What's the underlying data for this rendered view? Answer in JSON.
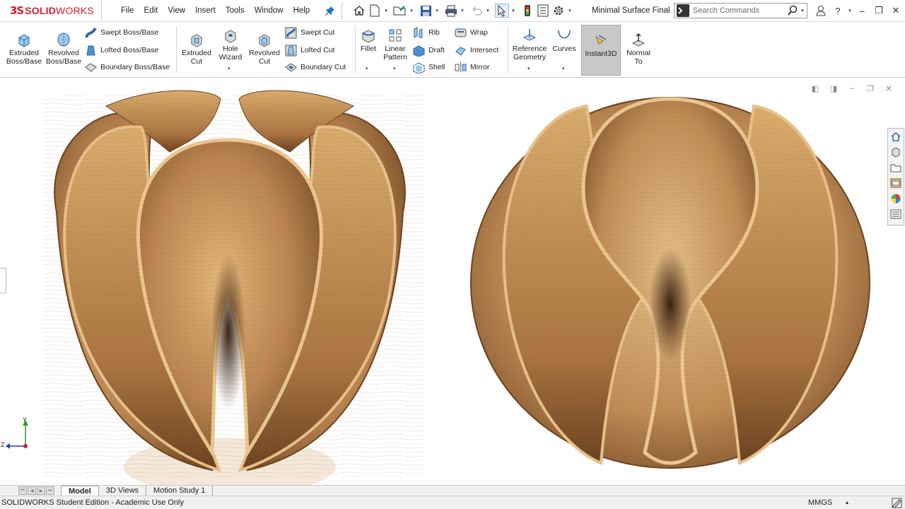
{
  "app": {
    "logo_ds": "3S",
    "logo_solid": "SOLID",
    "logo_works": "WORKS",
    "doc_title": "Minimal Surface Final"
  },
  "menu": [
    "File",
    "Edit",
    "View",
    "Insert",
    "Tools",
    "Window",
    "Help"
  ],
  "search": {
    "placeholder": "Search Commands"
  },
  "ribbon": {
    "extruded_boss": [
      "Extruded",
      "Boss/Base"
    ],
    "revolved_boss": [
      "Revolved",
      "Boss/Base"
    ],
    "swept_boss": "Swept Boss/Base",
    "lofted_boss": "Lofted Boss/Base",
    "boundary_boss": "Boundary Boss/Base",
    "extruded_cut": [
      "Extruded",
      "Cut"
    ],
    "hole_wizard": [
      "Hole",
      "Wizard"
    ],
    "revolved_cut": [
      "Revolved",
      "Cut"
    ],
    "swept_cut": "Swept Cut",
    "lofted_cut": "Lofted Cut",
    "boundary_cut": "Boundary Cut",
    "fillet": "Fillet",
    "linear_pattern": [
      "Linear",
      "Pattern"
    ],
    "rib": "Rib",
    "draft": "Draft",
    "shell": "Shell",
    "wrap": "Wrap",
    "intersect": "Intersect",
    "mirror": "Mirror",
    "reference_geometry": [
      "Reference",
      "Geometry"
    ],
    "curves": "Curves",
    "instant3d": "Instant3D",
    "normal_to": [
      "Normal",
      "To"
    ]
  },
  "triad": {
    "x": "Z",
    "y": "Y"
  },
  "tabs": [
    "Model",
    "3D Views",
    "Motion Study 1"
  ],
  "status": {
    "message": "SOLIDWORKS Student Edition - Academic Use Only",
    "units": "MMGS"
  },
  "colors": {
    "brand": "#d61e2a",
    "wood_light": "#d9a867",
    "wood_dark": "#6b4220"
  }
}
